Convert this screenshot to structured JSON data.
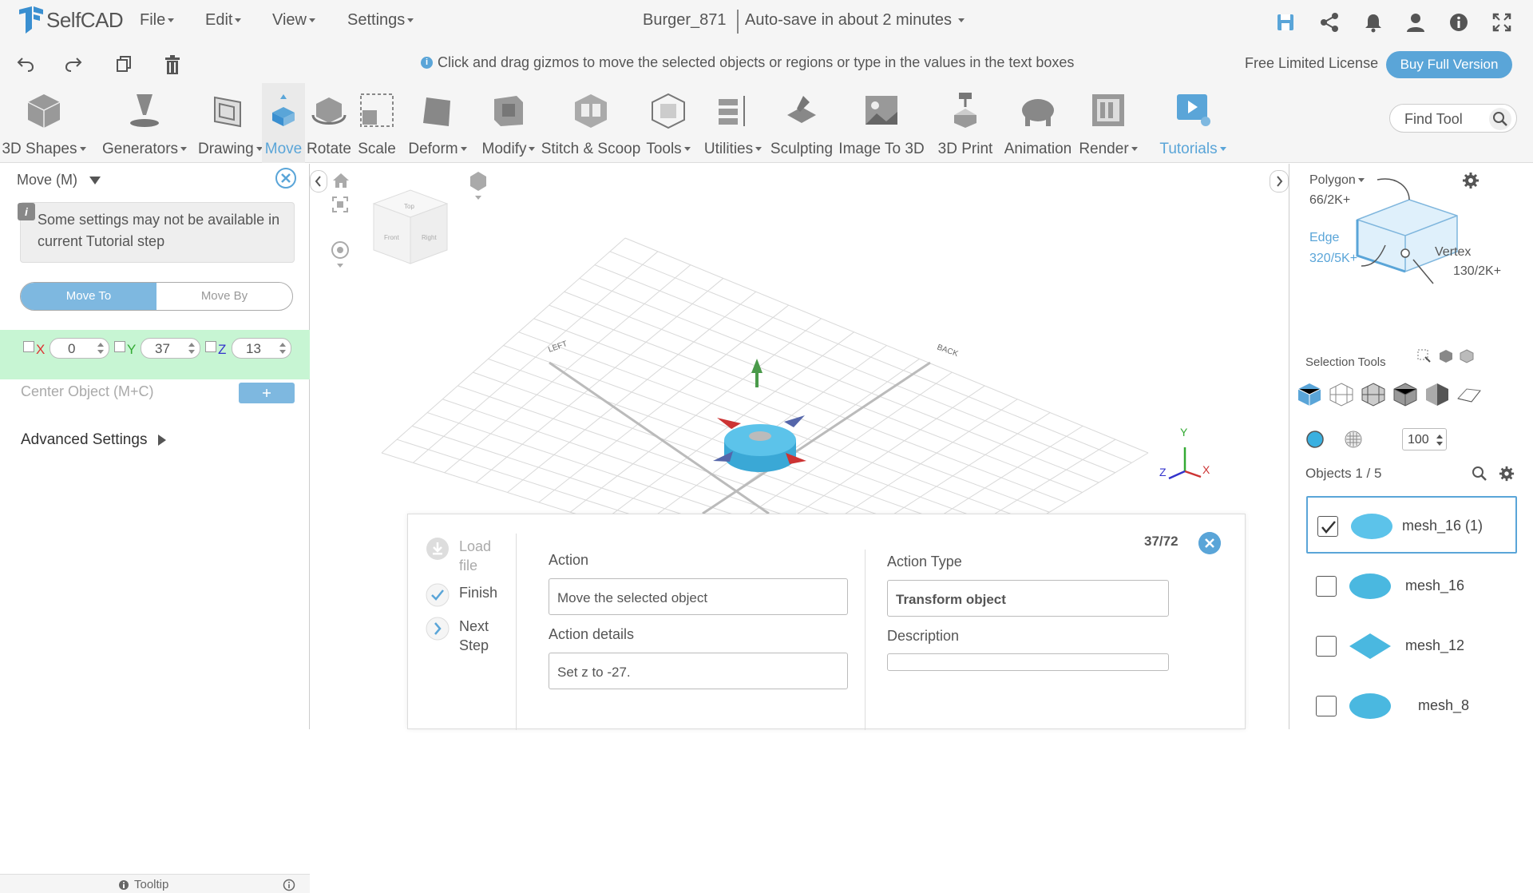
{
  "app": {
    "name": "SelfCAD"
  },
  "menu": {
    "file": "File",
    "edit": "Edit",
    "view": "View",
    "settings": "Settings"
  },
  "document": {
    "title": "Burger_871",
    "autosave": "Auto-save in about 2 minutes"
  },
  "hint": "Click and drag gizmos to move the selected objects or regions or type in the values in the text boxes",
  "license": {
    "text": "Free Limited License",
    "buy_label": "Buy Full Version"
  },
  "tools": [
    {
      "label": "3D Shapes",
      "icon": "cube-icon",
      "dropdown": true
    },
    {
      "label": "Generators",
      "icon": "generators-icon",
      "dropdown": true
    },
    {
      "label": "Drawing",
      "icon": "drawing-icon",
      "dropdown": true
    },
    {
      "label": "Move",
      "icon": "move-icon",
      "dropdown": false,
      "active": true
    },
    {
      "label": "Rotate",
      "icon": "rotate-icon",
      "dropdown": false
    },
    {
      "label": "Scale",
      "icon": "scale-icon",
      "dropdown": false
    },
    {
      "label": "Deform",
      "icon": "deform-icon",
      "dropdown": true
    },
    {
      "label": "Modify",
      "icon": "modify-icon",
      "dropdown": true
    },
    {
      "label": "Stitch & Scoop",
      "icon": "stitch-scoop-icon",
      "dropdown": false
    },
    {
      "label": "Tools",
      "icon": "tools-icon",
      "dropdown": true
    },
    {
      "label": "Utilities",
      "icon": "utilities-icon",
      "dropdown": true
    },
    {
      "label": "Sculpting",
      "icon": "sculpting-icon",
      "dropdown": false
    },
    {
      "label": "Image To 3D",
      "icon": "image-to-3d-icon",
      "dropdown": false
    },
    {
      "label": "3D Print",
      "icon": "3d-print-icon",
      "dropdown": false
    },
    {
      "label": "Animation",
      "icon": "animation-icon",
      "dropdown": false
    },
    {
      "label": "Render",
      "icon": "render-icon",
      "dropdown": true
    },
    {
      "label": "Tutorials",
      "icon": "tutorials-icon",
      "dropdown": true
    }
  ],
  "find_tool": {
    "placeholder": "Find Tool"
  },
  "left_panel": {
    "title": "Move (M)",
    "notice": "Some settings may not be available in current Tutorial step",
    "mode_move_to": "Move To",
    "mode_move_by": "Move By",
    "coords": {
      "x_label": "X",
      "x": "0",
      "y_label": "Y",
      "y": "37",
      "z_label": "Z",
      "z": "13"
    },
    "center_object": "Center Object (M+C)",
    "advanced": "Advanced Settings",
    "tooltip": "Tooltip"
  },
  "viewport": {
    "grid_label_left": "LEFT",
    "grid_label_back": "BACK",
    "cube_top": "Top",
    "cube_front": "Front",
    "cube_right": "Right",
    "axis_x": "X",
    "axis_y": "Y",
    "axis_z": "Z"
  },
  "tutorial": {
    "steps": [
      {
        "label": "Load file",
        "state": "pending"
      },
      {
        "label": "Finish",
        "state": "done"
      },
      {
        "label": "Next Step",
        "state": "next"
      }
    ],
    "counter": "37/72",
    "action_label": "Action",
    "action_value": "Move the selected object",
    "details_label": "Action details",
    "details_value": "Set z to -27.",
    "type_label": "Action Type",
    "type_value": "Transform object",
    "description_label": "Description",
    "description_value": ""
  },
  "right_panel": {
    "mode": "Polygon",
    "polygon_count": "66/2K+",
    "edge_label": "Edge",
    "edge_count": "320/5K+",
    "vertex_label": "Vertex",
    "vertex_count": "130/2K+",
    "selection_tools": "Selection Tools",
    "brush_size": "100",
    "objects_header": "Objects 1 / 5",
    "objects": [
      {
        "name": "mesh_16 (1)",
        "checked": true
      },
      {
        "name": "mesh_16",
        "checked": false
      },
      {
        "name": "mesh_12",
        "checked": false
      },
      {
        "name": "mesh_8",
        "checked": false
      }
    ]
  },
  "colors": {
    "accent": "#5aa5d8",
    "mesh": "#4ab8e0",
    "coords_bg": "#c7f5d3"
  }
}
